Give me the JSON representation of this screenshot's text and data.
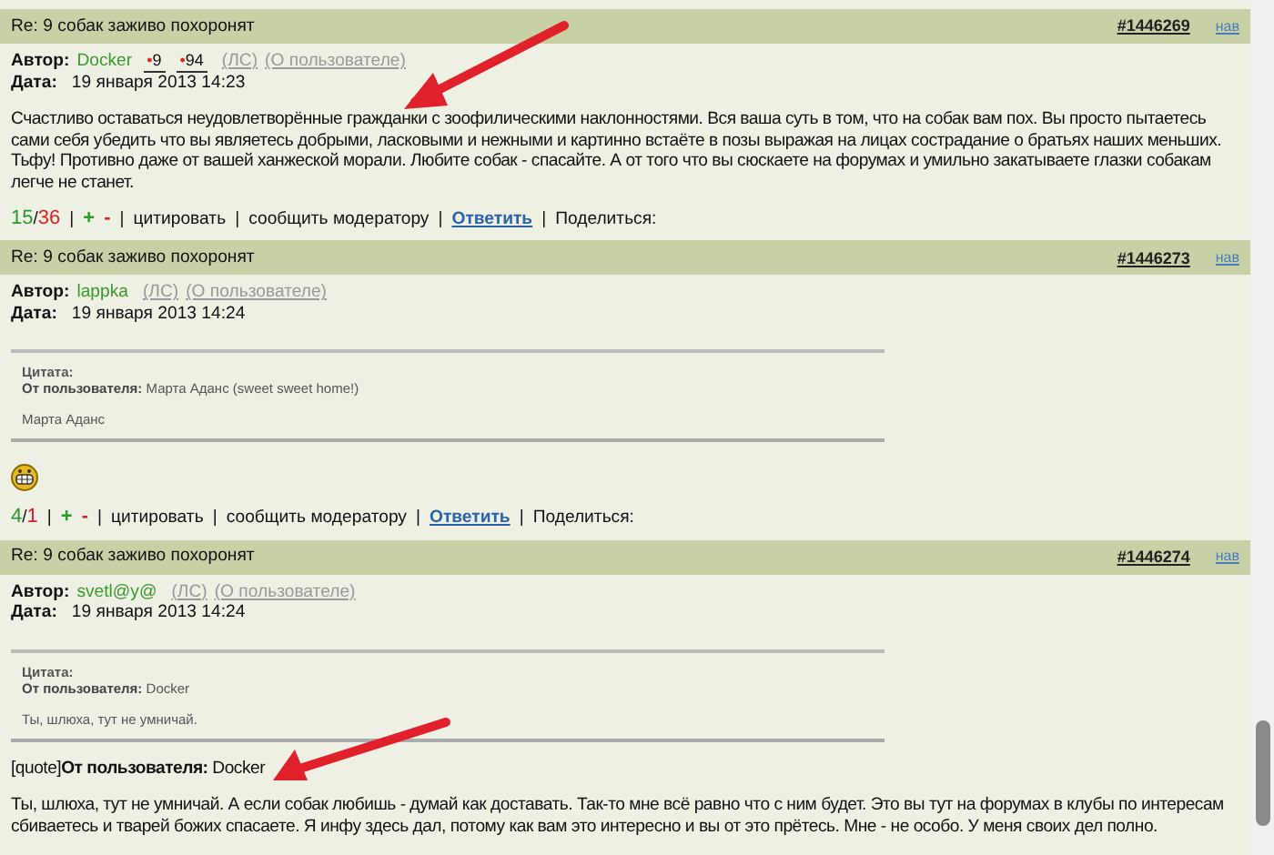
{
  "posts": [
    {
      "title": "Re: 9 собак заживо похоронят",
      "number": "#1446269",
      "nav": "нав",
      "author_label": "Автор:",
      "author": "Docker",
      "rating_mark": "•",
      "ratings": [
        "9",
        "94"
      ],
      "pm": "(ЛС)",
      "profile": "(О пользователе)",
      "date_label": "Дата:",
      "date": "19 января 2013 14:23",
      "body": [
        {
          "kind": "text",
          "text": "Счастливо оставаться неудовлетворённые гражданки с зоофилическими наклонностями. Вся ваша суть в том, что на собак вам пох. Вы просто пытаетесь сами себя убедить что вы являетесь добрыми, ласковыми и нежными и картинно встаёте в позы выражая на лицах сострадание о братьях наших меньших. Тьфу! Противно даже от вашей ханжеской морали. Любите собак - спасайте. А от того что вы сюскаете на форумах и умильно закатываете глазки собакам легче не станет."
        }
      ],
      "footer": {
        "slash": "/",
        "separator": "|",
        "plus_count": "15",
        "minus_count": "36",
        "plus": "+",
        "minus": "-",
        "quote_link": "цитировать",
        "report_link": "сообщить модератору",
        "reply_link": "Ответить",
        "share": "Поделиться:"
      }
    },
    {
      "title": "Re: 9 собак заживо похоронят",
      "number": "#1446273",
      "nav": "нав",
      "author_label": "Автор:",
      "author": "lappka",
      "pm": "(ЛС)",
      "profile": "(О пользователе)",
      "date_label": "Дата:",
      "date": "19 января 2013 14:24",
      "body": [
        {
          "kind": "quote",
          "label": "Цитата:",
          "from": "**От пользователя:** Марта Аданс (sweet sweet home!)",
          "text": "Марта Аданс"
        },
        {
          "kind": "smiley"
        }
      ],
      "footer": {
        "slash": "/",
        "separator": "|",
        "plus_count": "4",
        "minus_count": "1",
        "plus": "+",
        "minus": "-",
        "quote_link": "цитировать",
        "report_link": "сообщить модератору",
        "reply_link": "Ответить",
        "share": "Поделиться:"
      }
    },
    {
      "title": "Re: 9 собак заживо похоронят",
      "number": "#1446274",
      "nav": "нав",
      "author_label": "Автор:",
      "author": "svetl@y@",
      "pm": "(ЛС)",
      "profile": "(О пользователе)",
      "date_label": "Дата:",
      "date": "19 января 2013 14:24",
      "body": [
        {
          "kind": "quote",
          "label": "Цитата:",
          "from": "**От пользователя:** Docker",
          "text": "Ты, шлюха, тут не умничай."
        },
        {
          "kind": "text",
          "text": "[quote]**От пользователя:** Docker"
        },
        {
          "kind": "text",
          "text": "Ты, шлюха, тут не умничай. А если собак любишь - думай как доставать. Так-то мне всё равно что с ним будет. Это вы тут на форумах в клубы по интересам сбиваетесь и тварей божих спасаете. Я инфу здесь дал, потому как вам это интересно и вы от это прётесь. Мне - не особо. У меня своих дел полно."
        }
      ]
    }
  ]
}
